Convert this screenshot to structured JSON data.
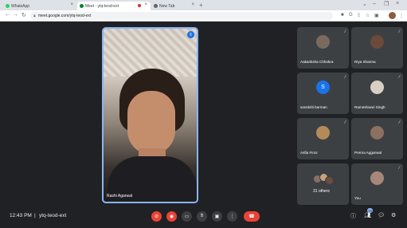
{
  "browser": {
    "tabs": [
      {
        "label": "WhatsApp",
        "favicon_color": "#25d366"
      },
      {
        "label": "Meet - ytq-teod-ext",
        "favicon_color": "#00832d",
        "recording": true
      },
      {
        "label": "New Tab",
        "favicon_color": "#5f6368"
      }
    ],
    "new_tab_icon": "plus-icon",
    "url": "meet.google.com/ytq-teod-ext"
  },
  "meeting": {
    "time": "12:43 PM",
    "separator": "|",
    "code": "ytq-teod-ext",
    "people_count": "39",
    "main_speaker_name": "Rashi Agarwal"
  },
  "participants": [
    {
      "name": "Aakanksha Chhokra",
      "avatar_color": "#7a6a5e",
      "type": "photo"
    },
    {
      "name": "Riya Sharma",
      "avatar_color": "#6b4a3a",
      "type": "photo"
    },
    {
      "name": "sanskriti barman",
      "avatar_color": "#1a73e8",
      "type": "initial",
      "initial": "S"
    },
    {
      "name": "Rameshwari Singh",
      "avatar_color": "#d8cfc4",
      "type": "photo"
    },
    {
      "name": "Asfia Firoz",
      "avatar_color": "#b58a5a",
      "type": "photo"
    },
    {
      "name": "Prerna Aggarwal",
      "avatar_color": "#8c7060",
      "type": "photo"
    },
    {
      "name": "31 others",
      "avatar_color": "#8d6e63",
      "type": "group"
    },
    {
      "name": "You",
      "avatar_color": "#a68878",
      "type": "photo"
    }
  ],
  "colors": {
    "background": "#202124",
    "tile": "#3c4043",
    "accent_blue": "#8ab4f8",
    "danger_red": "#ea4335"
  }
}
